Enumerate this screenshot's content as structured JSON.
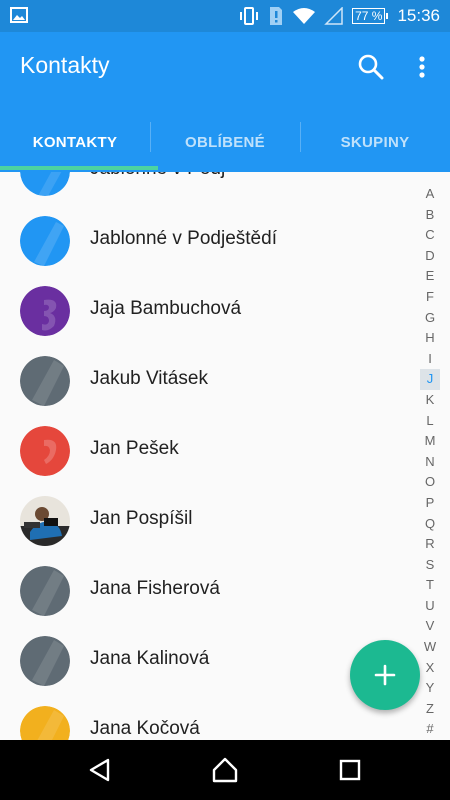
{
  "status_bar": {
    "battery": "77 %",
    "time": "15:36"
  },
  "app_bar": {
    "title": "Kontakty",
    "tabs": [
      {
        "label": "KONTAKTY",
        "active": true
      },
      {
        "label": "OBLÍBENÉ",
        "active": false
      },
      {
        "label": "SKUPINY",
        "active": false
      }
    ]
  },
  "contacts": [
    {
      "name": "Jablonné v Podj",
      "avatar_color": "#2196f3"
    },
    {
      "name": "Jablonné v Podještědí",
      "avatar_color": "#2196f3"
    },
    {
      "name": "Jaja Bambuchová",
      "avatar_color": "#6a2fa0"
    },
    {
      "name": "Jakub Vitásek",
      "avatar_color": "#5f6b74"
    },
    {
      "name": "Jan Pešek",
      "avatar_color": "#e5473c"
    },
    {
      "name": "Jan Pospíšil",
      "avatar_color": "photo"
    },
    {
      "name": "Jana Fisherová",
      "avatar_color": "#5f6b74"
    },
    {
      "name": "Jana Kalinová",
      "avatar_color": "#5f6b74"
    },
    {
      "name": "Jana Kočová",
      "avatar_color": "#f2b01e"
    }
  ],
  "index_letters": [
    "A",
    "B",
    "C",
    "D",
    "E",
    "F",
    "G",
    "H",
    "I",
    "J",
    "K",
    "L",
    "M",
    "N",
    "O",
    "P",
    "Q",
    "R",
    "S",
    "T",
    "U",
    "V",
    "W",
    "X",
    "Y",
    "Z",
    "#"
  ],
  "index_active": "J",
  "colors": {
    "primary": "#2196f3",
    "status_bar": "#1e88d8",
    "accent": "#1cb991",
    "tab_indicator": "#4cd3a1"
  }
}
